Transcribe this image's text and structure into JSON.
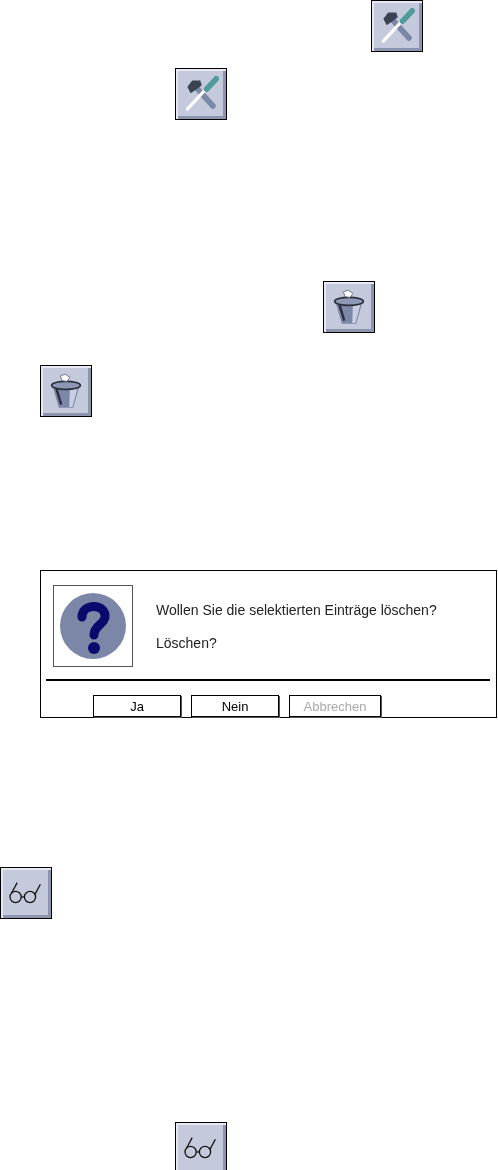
{
  "dialog": {
    "messages": [
      "Wollen Sie die selektierten Einträge löschen?",
      "Löschen?"
    ],
    "buttons": [
      {
        "label": "Ja",
        "disabled": false
      },
      {
        "label": "Nein",
        "disabled": false
      },
      {
        "label": "Abbrechen",
        "disabled": true
      }
    ]
  }
}
